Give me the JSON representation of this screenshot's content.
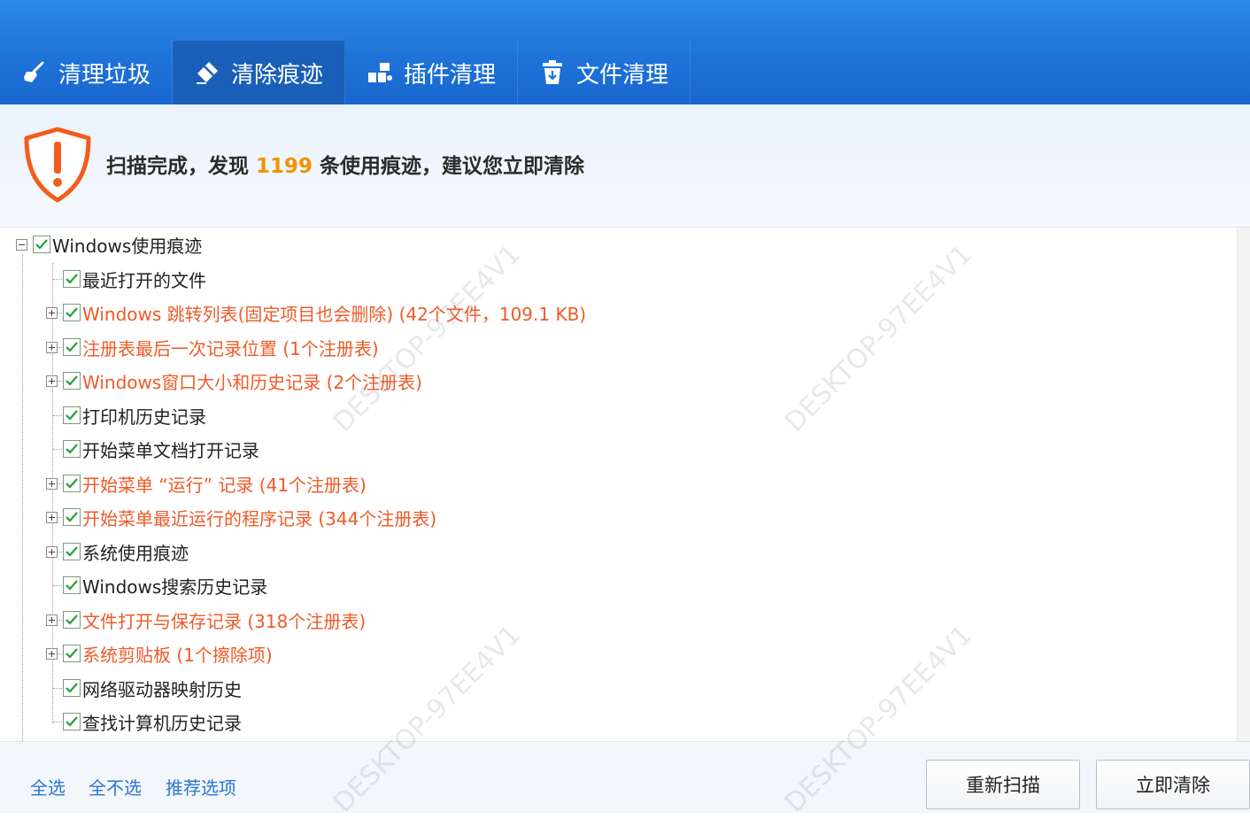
{
  "tabs": [
    {
      "label": "清理垃圾",
      "icon": "broom-icon",
      "active": false
    },
    {
      "label": "清除痕迹",
      "icon": "eraser-icon",
      "active": true
    },
    {
      "label": "插件清理",
      "icon": "plugin-icon",
      "active": false
    },
    {
      "label": "文件清理",
      "icon": "trash-bin-icon",
      "active": false
    }
  ],
  "summary": {
    "prefix": "扫描完成，发现",
    "count": "1199",
    "suffix": "条使用痕迹，建议您立即清除",
    "icon": "warning-shield-icon"
  },
  "tree": {
    "root": {
      "label": "Windows使用痕迹",
      "checked": true,
      "expanded": true
    },
    "items": [
      {
        "label": "最近打开的文件",
        "expandable": false,
        "highlight": false,
        "checked": true
      },
      {
        "label": "Windows 跳转列表(固定项目也会删除) (42个文件，109.1 KB)",
        "expandable": true,
        "highlight": true,
        "checked": true
      },
      {
        "label": "注册表最后一次记录位置 (1个注册表)",
        "expandable": true,
        "highlight": true,
        "checked": true
      },
      {
        "label": "Windows窗口大小和历史记录 (2个注册表)",
        "expandable": true,
        "highlight": true,
        "checked": true
      },
      {
        "label": "打印机历史记录",
        "expandable": false,
        "highlight": false,
        "checked": true
      },
      {
        "label": "开始菜单文档打开记录",
        "expandable": false,
        "highlight": false,
        "checked": true
      },
      {
        "label": "开始菜单 “运行” 记录 (41个注册表)",
        "expandable": true,
        "highlight": true,
        "checked": true
      },
      {
        "label": "开始菜单最近运行的程序记录 (344个注册表)",
        "expandable": true,
        "highlight": true,
        "checked": true
      },
      {
        "label": "系统使用痕迹",
        "expandable": true,
        "highlight": false,
        "checked": true
      },
      {
        "label": "Windows搜索历史记录",
        "expandable": false,
        "highlight": false,
        "checked": true
      },
      {
        "label": "文件打开与保存记录 (318个注册表)",
        "expandable": true,
        "highlight": true,
        "checked": true
      },
      {
        "label": "系统剪贴板 (1个擦除项)",
        "expandable": true,
        "highlight": true,
        "checked": true
      },
      {
        "label": "网络驱动器映射历史",
        "expandable": false,
        "highlight": false,
        "checked": true
      },
      {
        "label": "查找计算机历史记录",
        "expandable": false,
        "highlight": false,
        "checked": true
      }
    ]
  },
  "footer": {
    "select_all": "全选",
    "select_none": "全不选",
    "recommended": "推荐选项",
    "rescan": "重新扫描",
    "clean_now": "立即清除"
  },
  "watermark": "DESKTOP-97EE4V1",
  "colors": {
    "tab_bar": "#1f73d8",
    "tab_active": "#1a5fb8",
    "highlight_text": "#ef5a27",
    "count": "#f39200",
    "link": "#2a77d6",
    "check": "#22a03a"
  }
}
